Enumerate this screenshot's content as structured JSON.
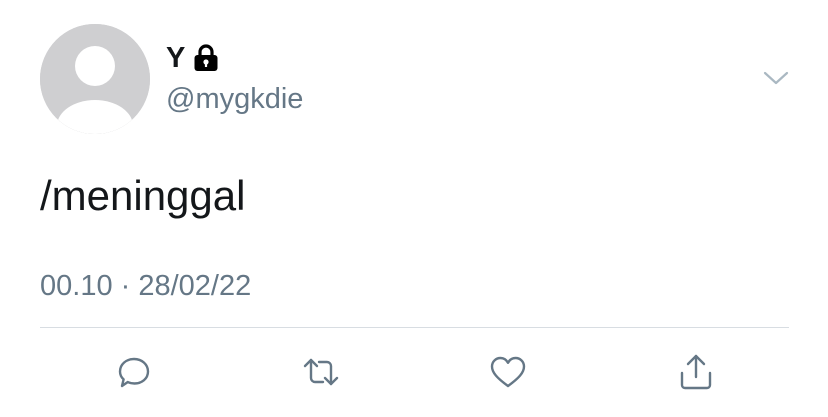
{
  "tweet": {
    "author": {
      "display_name": "Y",
      "handle": "@mygkdie",
      "protected_icon": "lock-icon",
      "avatar_icon": "default-avatar"
    },
    "text": "/meninggal",
    "timestamp": "00.10 · 28/02/22",
    "menu_icon": "chevron-down-icon"
  },
  "actions": [
    {
      "icon": "reply-icon"
    },
    {
      "icon": "retweet-icon"
    },
    {
      "icon": "like-icon"
    },
    {
      "icon": "share-icon"
    }
  ],
  "colors": {
    "text_primary": "#14171a",
    "text_secondary": "#657786",
    "icon": "#657786",
    "divider": "#d8dde2",
    "avatar_bg": "#cfcfd1",
    "avatar_fg": "#ffffff",
    "background": "#ffffff"
  }
}
